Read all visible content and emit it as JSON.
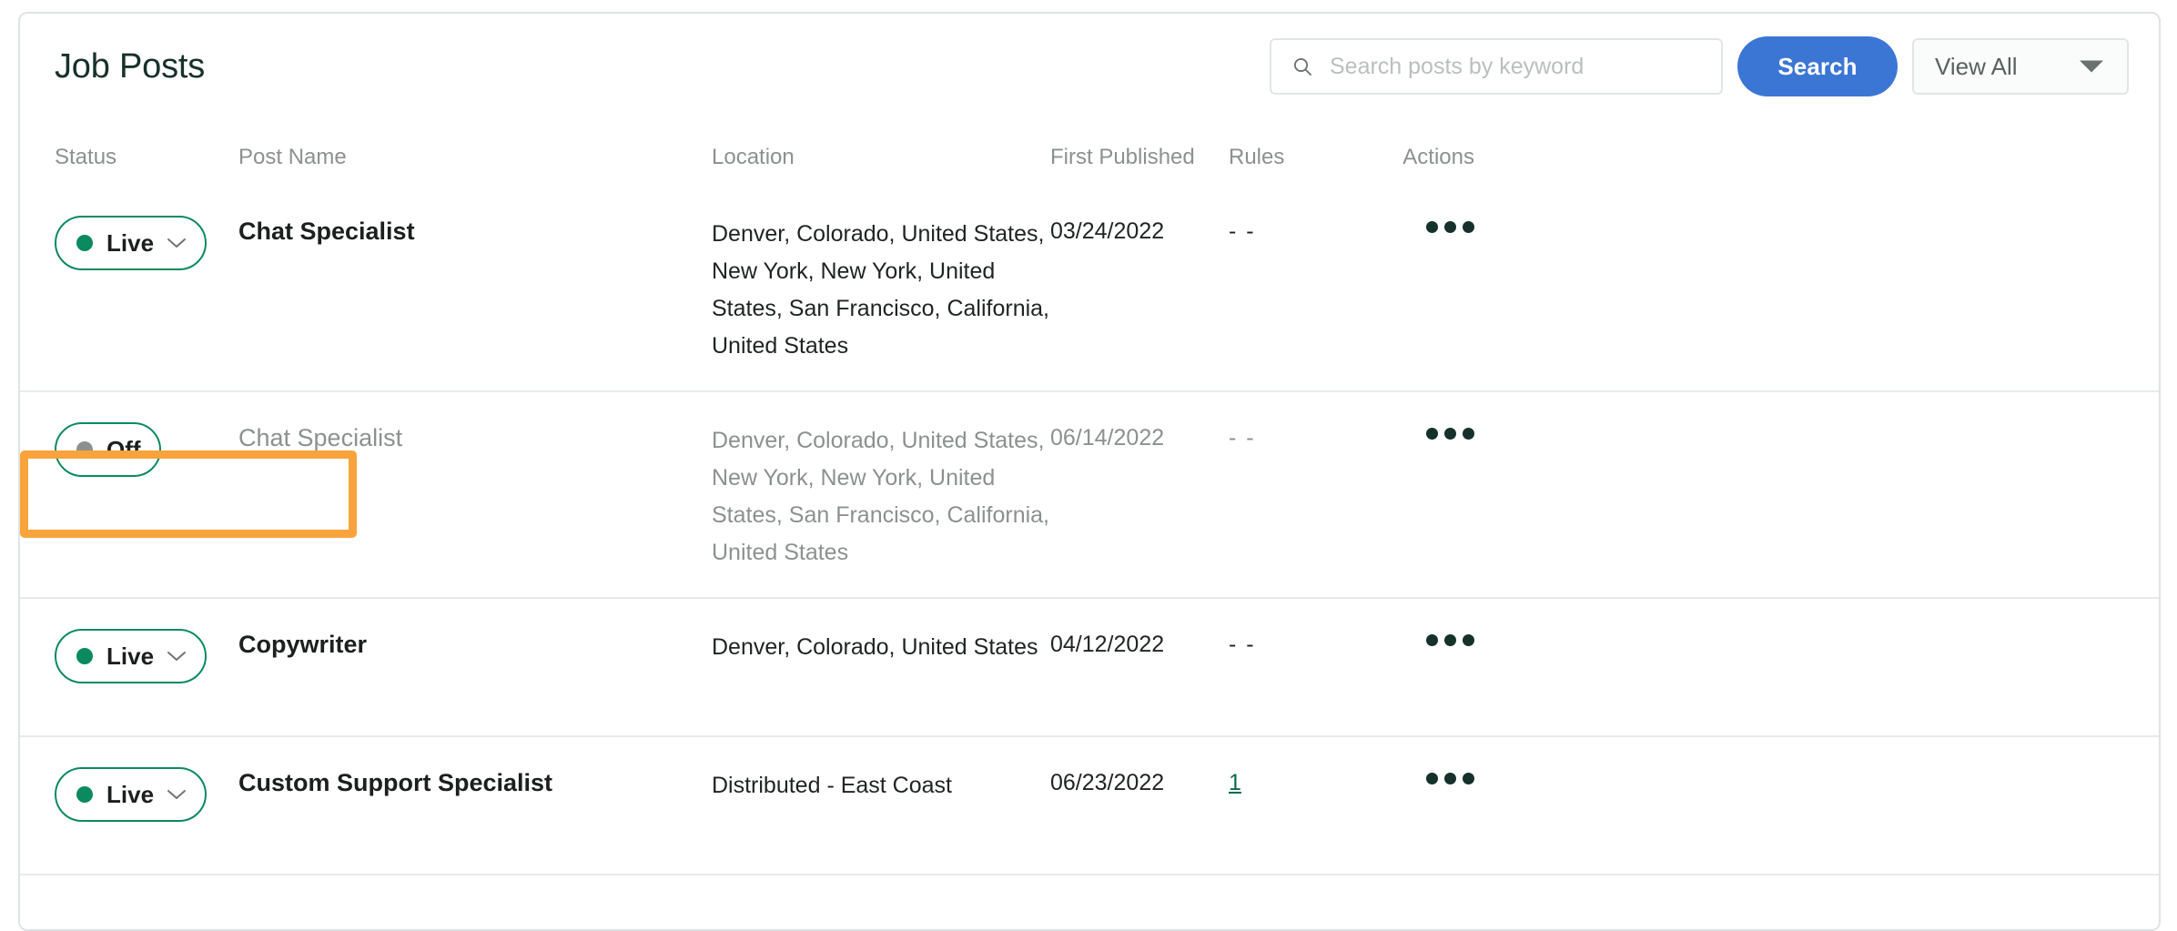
{
  "header": {
    "title": "Job Posts",
    "search": {
      "placeholder": "Search posts by keyword",
      "value": "",
      "icon": "search-icon"
    },
    "search_button_label": "Search",
    "view_filter": {
      "selected": "View All",
      "icon": "chevron-down-icon"
    }
  },
  "table": {
    "columns": [
      {
        "key": "status",
        "label": "Status"
      },
      {
        "key": "name",
        "label": "Post Name"
      },
      {
        "key": "location",
        "label": "Location"
      },
      {
        "key": "date",
        "label": "First Published"
      },
      {
        "key": "rules",
        "label": "Rules"
      },
      {
        "key": "actions",
        "label": "Actions"
      }
    ],
    "rows": [
      {
        "status": "Live",
        "status_state": "live",
        "name": "Chat Specialist",
        "location": "Denver, Colorado, United States, New York, New York, United States, San Francisco, California, United States",
        "date": "03/24/2022",
        "rules": "- -",
        "rules_is_link": false,
        "actions_icon": "kebab-menu-icon",
        "muted": false,
        "highlighted": false
      },
      {
        "status": "Off",
        "status_state": "off",
        "name": "Chat Specialist",
        "location": "Denver, Colorado, United States, New York, New York, United States, San Francisco, California, United States",
        "date": "06/14/2022",
        "rules": "- -",
        "rules_is_link": false,
        "actions_icon": "kebab-menu-icon",
        "muted": true,
        "highlighted": true
      },
      {
        "status": "Live",
        "status_state": "live",
        "name": "Copywriter",
        "location": "Denver, Colorado, United States",
        "date": "04/12/2022",
        "rules": "- -",
        "rules_is_link": false,
        "actions_icon": "kebab-menu-icon",
        "muted": false,
        "highlighted": false
      },
      {
        "status": "Live",
        "status_state": "live",
        "name": "Custom Support Specialist",
        "location": "Distributed - East Coast",
        "date": "06/23/2022",
        "rules": "1",
        "rules_is_link": true,
        "actions_icon": "kebab-menu-icon",
        "muted": false,
        "highlighted": false
      }
    ]
  },
  "colors": {
    "accent_blue": "#3b76d4",
    "status_green": "#0b8a5f",
    "link_green": "#0b6b4f",
    "highlight_orange": "#f9a33c",
    "muted_gray": "#8b9190",
    "title_dark": "#16312b"
  }
}
